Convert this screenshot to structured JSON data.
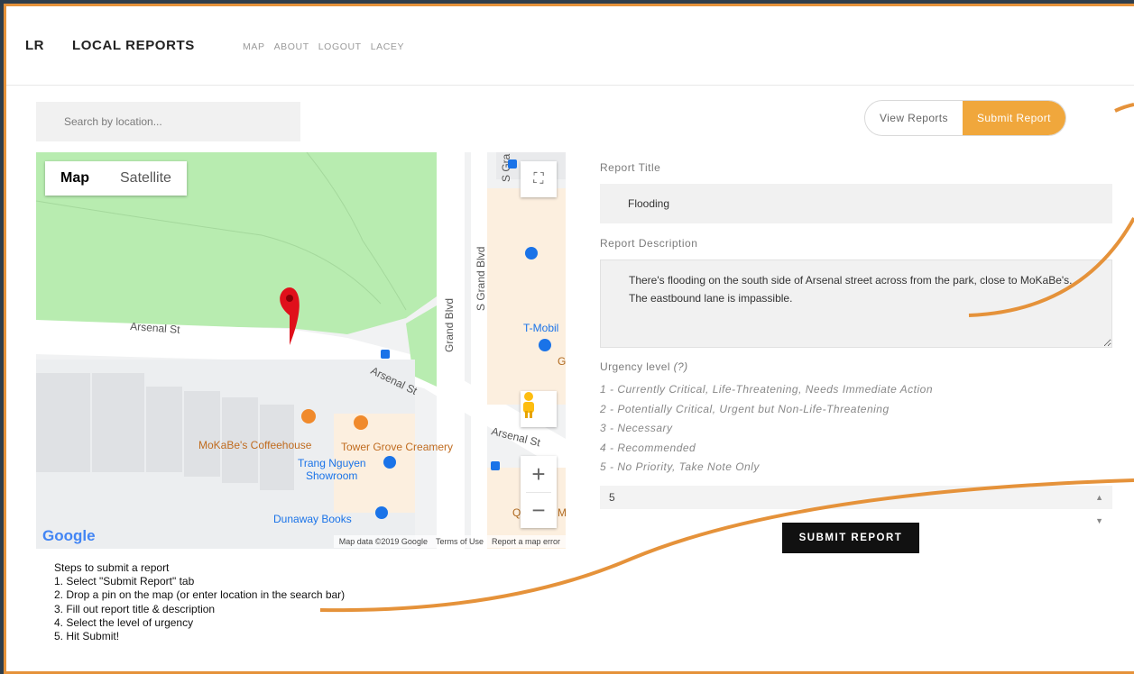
{
  "nav": {
    "brand_short": "LR",
    "brand_name": "LOCAL REPORTS",
    "links": [
      "MAP",
      "ABOUT",
      "LOGOUT",
      "LACEY"
    ]
  },
  "search": {
    "placeholder": "Search by location..."
  },
  "tabs": {
    "view": "View Reports",
    "submit": "Submit Report"
  },
  "map": {
    "type_map": "Map",
    "type_satellite": "Satellite",
    "labels": {
      "arsenal_1": "Arsenal St",
      "arsenal_2": "Arsenal St",
      "arsenal_3": "Arsenal St",
      "grand_blvd": "Grand Blvd",
      "s_grand_blvd": "S Grand Blvd",
      "s_gra": "S Gra",
      "tmobile": "T-Mobil",
      "g": "G",
      "q": "Q",
      "m": "M",
      "mokabes": "MoKaBe's Coffeehouse",
      "tower_grove": "Tower Grove Creamery",
      "trang_1": "Trang Nguyen",
      "trang_2": "Showroom",
      "dunaway": "Dunaway Books"
    },
    "google": "Google",
    "footer_data": "Map data ©2019 Google",
    "footer_terms": "Terms of Use",
    "footer_error": "Report a map error",
    "zoom_in": "+",
    "zoom_out": "−"
  },
  "form": {
    "title_label": "Report Title",
    "title_value": "Flooding",
    "desc_label": "Report Description",
    "desc_value": "There's flooding on the south side of Arsenal street across from the park, close to MoKaBe's. The eastbound lane is impassible.",
    "urgency_label": "Urgency level",
    "urgency_help": "(?)",
    "levels": [
      "1 - Currently Critical, Life-Threatening, Needs Immediate Action",
      "2 - Potentially Critical, Urgent but Non-Life-Threatening",
      "3 - Necessary",
      "4 - Recommended",
      "5 - No Priority, Take Note Only"
    ],
    "selected_level": "5",
    "submit": "SUBMIT REPORT"
  },
  "steps": {
    "heading": "Steps to submit a report",
    "items": [
      "1. Select \"Submit Report\" tab",
      "2. Drop a pin on the map (or enter location in the search bar)",
      "3. Fill out report title & description",
      "4. Select the level of urgency",
      "5. Hit Submit!"
    ]
  },
  "colors": {
    "accent": "#f0a73c",
    "border": "#e5923a",
    "background": "#2f3e4c",
    "park": "#b8ecb0",
    "pin": "#e0101b"
  }
}
